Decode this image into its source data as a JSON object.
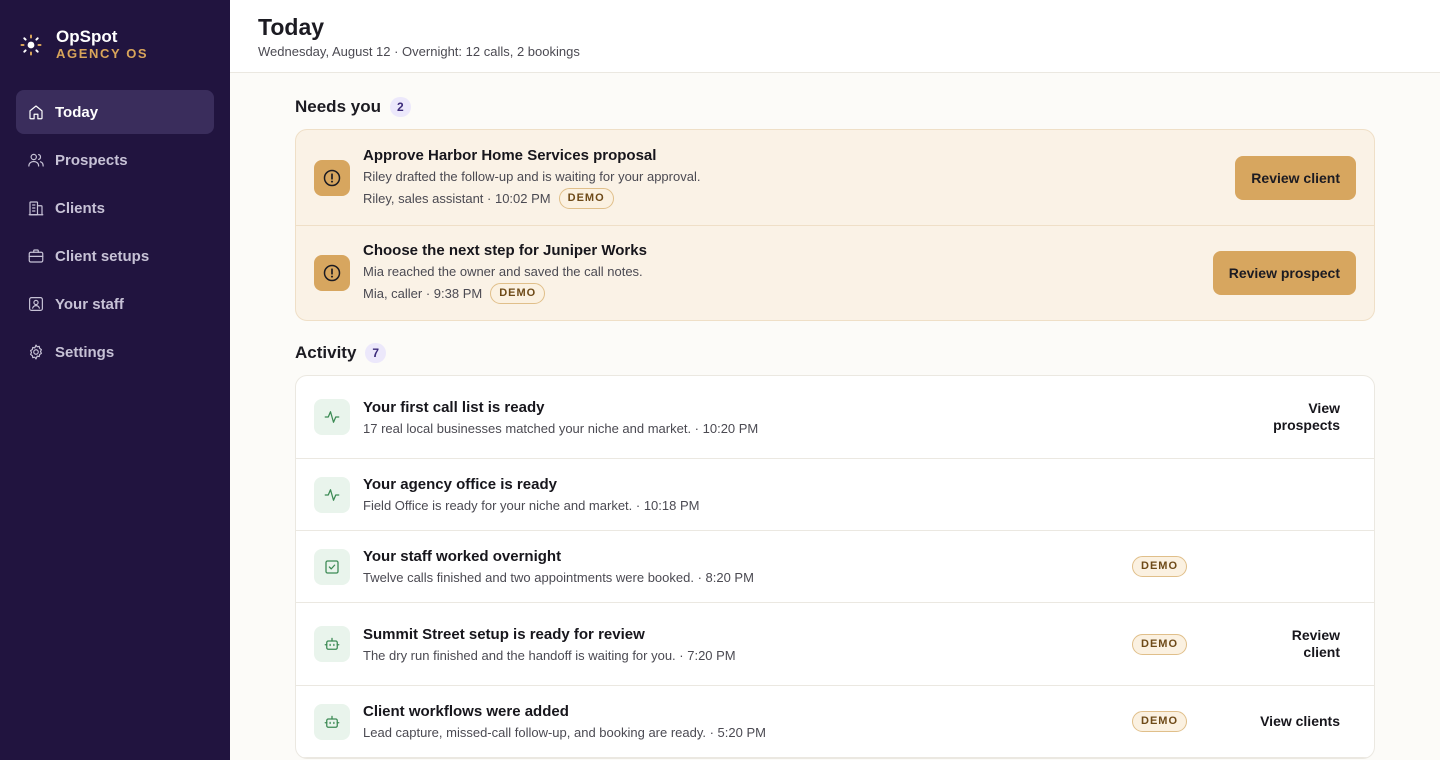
{
  "brand": {
    "name": "OpSpot",
    "sub": "AGENCY OS"
  },
  "nav": [
    {
      "label": "Today",
      "icon": "home-icon",
      "active": true
    },
    {
      "label": "Prospects",
      "icon": "users-icon"
    },
    {
      "label": "Clients",
      "icon": "building-icon"
    },
    {
      "label": "Client setups",
      "icon": "briefcase-icon"
    },
    {
      "label": "Your staff",
      "icon": "staff-icon"
    },
    {
      "label": "Settings",
      "icon": "gear-icon"
    }
  ],
  "header": {
    "title": "Today",
    "subtitle": "Wednesday, August 12 · Overnight: 12 calls, 2 bookings"
  },
  "needs": {
    "title": "Needs you",
    "count": "2",
    "items": [
      {
        "title": "Approve Harbor Home Services proposal",
        "desc": "Riley drafted the follow-up and is waiting for your approval.",
        "meta": "Riley, sales assistant · 10:02 PM",
        "badge": "DEMO",
        "action": "Review client"
      },
      {
        "title": "Choose the next step for Juniper Works",
        "desc": "Mia reached the owner and saved the call notes.",
        "meta": "Mia, caller · 9:38 PM",
        "badge": "DEMO",
        "action": "Review prospect"
      }
    ]
  },
  "activity": {
    "title": "Activity",
    "count": "7",
    "items": [
      {
        "title": "Your first call list is ready",
        "desc": "17 real local businesses matched your niche and market. · 10:20 PM",
        "badge": "",
        "action_1": "View",
        "action_2": "prospects",
        "icon": "activity-icon"
      },
      {
        "title": "Your agency office is ready",
        "desc": "Field Office is ready for your niche and market. · 10:18 PM",
        "badge": "",
        "action_1": "",
        "action_2": "",
        "icon": "activity-icon"
      },
      {
        "title": "Your staff worked overnight",
        "desc": "Twelve calls finished and two appointments were booked. · 8:20 PM",
        "badge": "DEMO",
        "action_1": "",
        "action_2": "",
        "icon": "checkbox-icon"
      },
      {
        "title": "Summit Street setup is ready for review",
        "desc": "The dry run finished and the handoff is waiting for you. · 7:20 PM",
        "badge": "DEMO",
        "action_1": "Review",
        "action_2": "client",
        "icon": "robot-icon"
      },
      {
        "title": "Client workflows were added",
        "desc": "Lead capture, missed-call follow-up, and booking are ready. · 5:20 PM",
        "badge": "DEMO",
        "action_1": "View clients",
        "action_2": "",
        "icon": "robot-icon"
      }
    ]
  },
  "colors": {
    "sidebar_bg": "#21143f",
    "accent_gold": "#d7a65f",
    "activity_green": "#3c8a54"
  }
}
